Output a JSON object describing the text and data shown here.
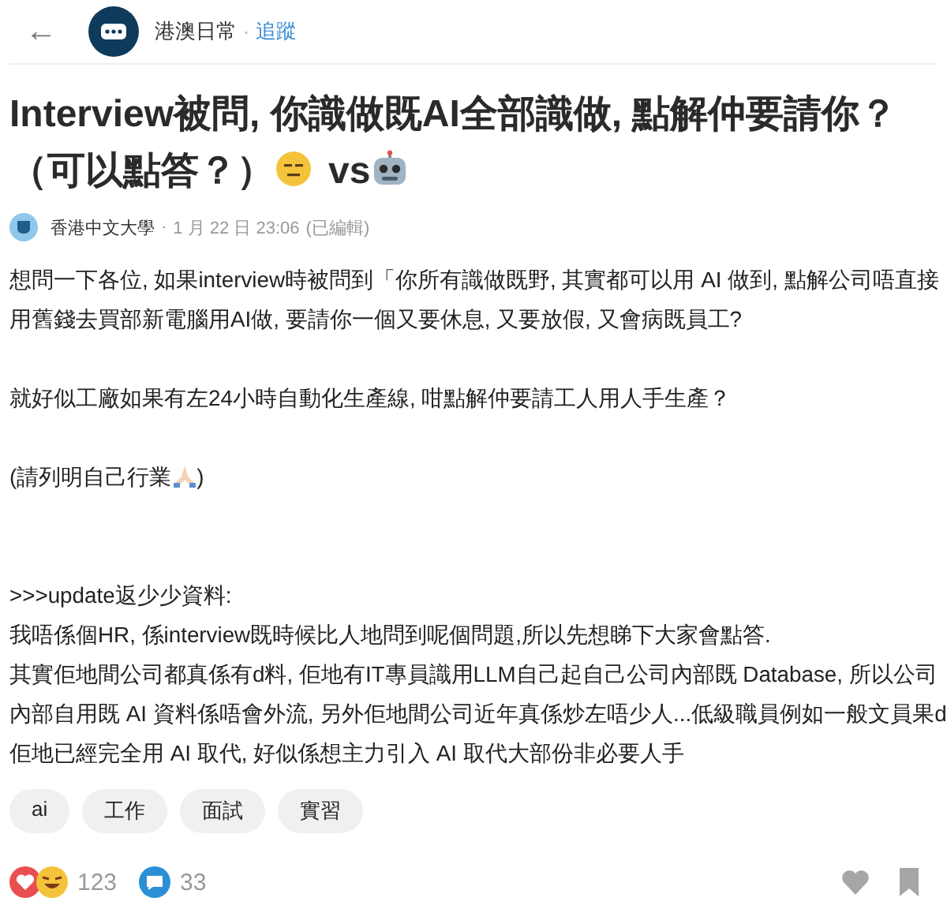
{
  "header": {
    "back": "←",
    "community": "港澳日常",
    "separator": "·",
    "follow": "追蹤"
  },
  "title": {
    "lines": [
      "Interview被問, 你識做既AI全部識做, 點解仲要請你？",
      "（可以點答？）"
    ],
    "vs": "vs"
  },
  "meta": {
    "author": "香港中文大學",
    "separator": "·",
    "time": "1 月 22 日 23:06",
    "edited": "(已編輯)"
  },
  "paragraphs": [
    {
      "kind": "text",
      "lines": [
        "想問一下各位, 如果interview時被問到「你所有識做既野, 其實都可以用 AI 做到, 點解公司唔直接",
        "用舊錢去買部新電腦用AI做, 要請你一個又要休息, 又要放假, 又會病既員工?"
      ]
    },
    {
      "kind": "text",
      "lines": [
        "就好似工廠如果有左24小時自動化生產線, 咁點解仲要請工人用人手生產？"
      ]
    },
    {
      "kind": "emoji",
      "before": "(請列明自己行業",
      "after": ")"
    },
    {
      "kind": "update",
      "lines": [
        ">>>update返少少資料:",
        "我唔係個HR, 係interview既時候比人地問到呢個問題,所以先想睇下大家會點答.",
        "其實佢地間公司都真係有d料, 佢地有IT專員識用LLM自己起自己公司內部既 Database, 所以公司",
        "內部自用既 AI 資料係唔會外流, 另外佢地間公司近年真係炒左唔少人...低級職員例如一般文員果d",
        "佢地已經完全用 AI 取代, 好似係想主力引入 AI 取代大部份非必要人手"
      ]
    }
  ],
  "tags": [
    "ai",
    "工作",
    "面試",
    "實習"
  ],
  "footer": {
    "reactions": "123",
    "comments": "33"
  }
}
